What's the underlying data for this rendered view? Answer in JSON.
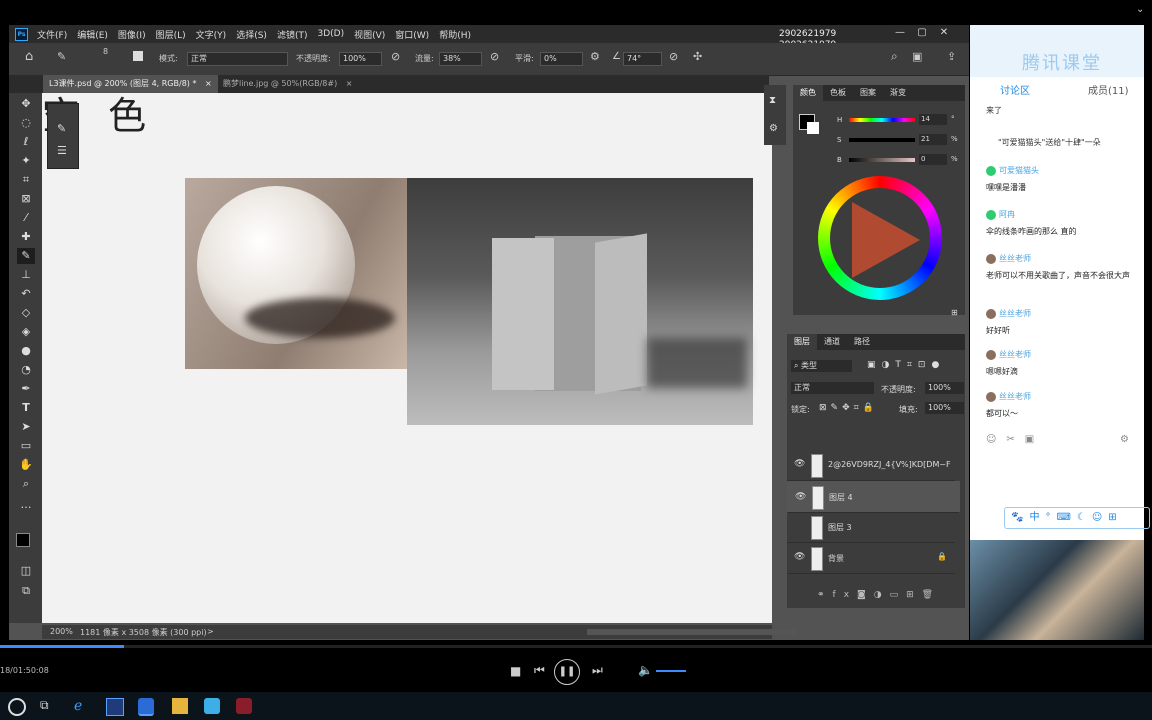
{
  "menu": {
    "logo": "Ps",
    "items": [
      "文件(F)",
      "编辑(E)",
      "图像(I)",
      "图层(L)",
      "文字(Y)",
      "选择(S)",
      "滤镜(T)",
      "3D(D)",
      "视图(V)",
      "窗口(W)",
      "帮助(H)"
    ],
    "watermark1": "2902621979",
    "watermark2": "2902621979"
  },
  "options": {
    "brush_size": "8",
    "mode_label": "模式:",
    "mode_value": "正常",
    "opacity_label": "不透明度:",
    "opacity_value": "100%",
    "flow_label": "流量:",
    "flow_value": "38%",
    "smooth_label": "平滑:",
    "smooth_value": "0%",
    "angle_value": "74°"
  },
  "doc_tabs": [
    {
      "label": "L3课件.psd @ 200% (图层 4, RGB/8) *",
      "close": "×"
    },
    {
      "label": "鹏梦line.jpg @ 50%(RGB/8#)",
      "close": "×"
    }
  ],
  "canvas": {
    "heading_text": "空 色"
  },
  "status": {
    "zoom": "200%",
    "doc_info": "1181 像素 x 3508 像素 (300 ppi)",
    "arrow": ">"
  },
  "color_panel": {
    "tabs": [
      "颜色",
      "色板",
      "图案",
      "渐变"
    ],
    "h_label": "H",
    "h_value": "14",
    "h_unit": "°",
    "s_label": "S",
    "s_value": "21",
    "s_unit": "%",
    "b_label": "B",
    "b_value": "0",
    "b_unit": "%"
  },
  "layers_panel": {
    "tabs": [
      "图层",
      "通道",
      "路径"
    ],
    "filter_label": "类型",
    "blend_mode": "正常",
    "opacity_label": "不透明度:",
    "opacity_value": "100%",
    "lock_label": "锁定:",
    "fill_label": "填充:",
    "fill_value": "100%",
    "layers": [
      {
        "name": "2@26VD9RZJ_4{V%]KD[DM~F",
        "visible": true,
        "selected": false
      },
      {
        "name": "图层 4",
        "visible": true,
        "selected": true
      },
      {
        "name": "图层 3",
        "visible": false,
        "selected": false
      },
      {
        "name": "背景",
        "visible": true,
        "selected": false,
        "locked": true
      }
    ]
  },
  "chat": {
    "brand": "腾讯课堂",
    "tab_discussion": "讨论区",
    "tab_members": "成员(11)",
    "messages": [
      {
        "type": "sys",
        "text": "来了"
      },
      {
        "type": "sys",
        "text": "\"可爱猫猫头\"送给\"十肆\"一朵"
      },
      {
        "type": "user",
        "name": "可爱猫猫头",
        "text": "嘿嘿是潘潘"
      },
      {
        "type": "user",
        "name": "阿冉",
        "text": "伞的线条咋画的那么 直的"
      },
      {
        "type": "user",
        "name": "丝丝老师",
        "text": "老师可以不用关歌曲了，声音不会很大声"
      },
      {
        "type": "user",
        "name": "丝丝老师",
        "text": "好好听"
      },
      {
        "type": "user",
        "name": "丝丝老师",
        "text": "嗯嗯好滴"
      },
      {
        "type": "user",
        "name": "丝丝老师",
        "text": "都可以～"
      }
    ],
    "ime_label": "中"
  },
  "player": {
    "time": "18/01:50:08"
  }
}
